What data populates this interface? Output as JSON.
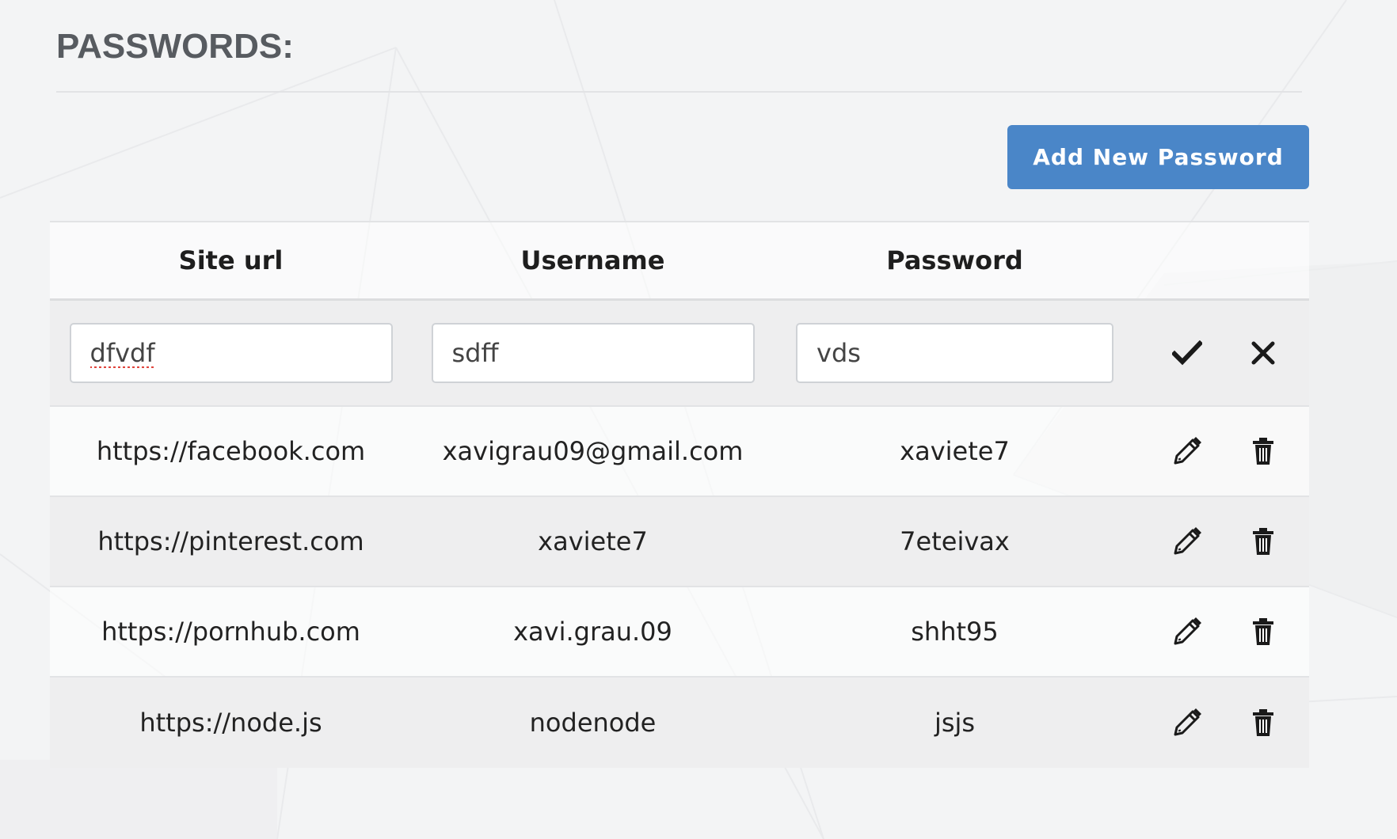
{
  "page": {
    "title": "PASSWORDS:",
    "add_button_label": "Add New Password"
  },
  "table": {
    "columns": [
      "Site url",
      "Username",
      "Password"
    ],
    "edit_row": {
      "site_url": "dfvdf",
      "username": "sdff",
      "password": "vds"
    },
    "rows": [
      {
        "site_url": "https://facebook.com",
        "username": "xavigrau09@gmail.com",
        "password": "xaviete7"
      },
      {
        "site_url": "https://pinterest.com",
        "username": "xaviete7",
        "password": "7eteivax"
      },
      {
        "site_url": "https://pornhub.com",
        "username": "xavi.grau.09",
        "password": "shht95"
      },
      {
        "site_url": "https://node.js",
        "username": "nodenode",
        "password": "jsjs"
      }
    ]
  },
  "icons": {
    "confirm": "check-icon",
    "cancel": "close-icon",
    "edit": "pencil-icon",
    "delete": "trash-icon"
  },
  "colors": {
    "accent": "#4a86c8",
    "title": "#575b60",
    "row_alt": "#eeeeef"
  }
}
